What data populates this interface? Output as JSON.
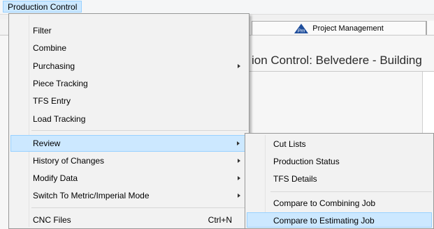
{
  "menubar": {
    "production_control": "Production Control"
  },
  "background": {
    "tab_label": "Project Management",
    "title": "ion Control: Belvedere - Building"
  },
  "main_menu": {
    "filter": "Filter",
    "combine": "Combine",
    "purchasing": "Purchasing",
    "piece_tracking": "Piece Tracking",
    "tfs_entry": "TFS Entry",
    "load_tracking": "Load Tracking",
    "review": "Review",
    "history_of_changes": "History of Changes",
    "modify_data": "Modify Data",
    "switch_mode": "Switch To Metric/Imperial Mode",
    "cnc_files": "CNC Files",
    "cnc_files_shortcut": "Ctrl+N"
  },
  "review_submenu": {
    "cut_lists": "Cut Lists",
    "production_status": "Production Status",
    "tfs_details": "TFS Details",
    "compare_combining": "Compare to Combining Job",
    "compare_estimating": "Compare to Estimating Job"
  },
  "colors": {
    "highlight": "#cce8ff",
    "highlight_border": "#99d1ff",
    "menu_bg": "#f2f2f2"
  },
  "icons": {
    "project_management": "pm-logo-icon",
    "submenu": "chevron-right-icon"
  }
}
